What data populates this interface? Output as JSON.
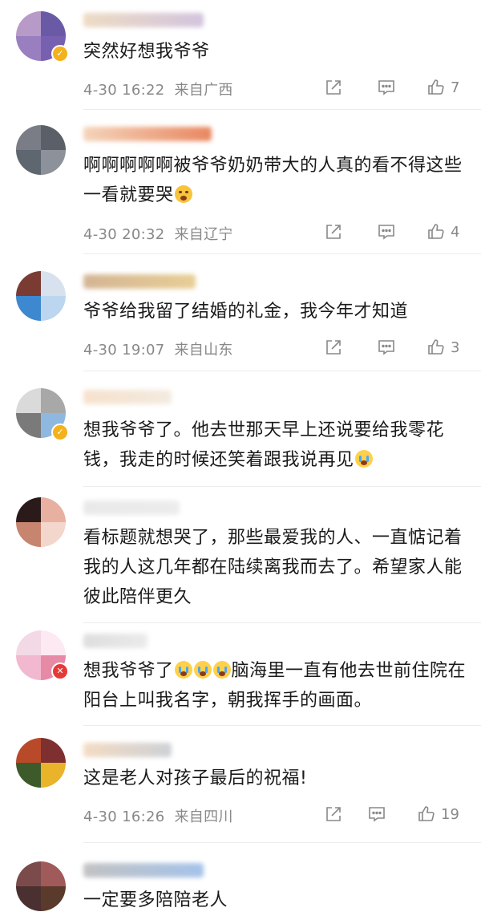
{
  "comments": [
    {
      "text": "突然好想我爷爷",
      "time": "4-30 16:22",
      "location": "来自广西",
      "likes": "7",
      "avatar_colors": [
        "#b89ac8",
        "#6a5aa6",
        "#9a7fc0",
        "#7860b0"
      ],
      "name_colors": [
        "#e9d3b5",
        "#c8b6d6"
      ],
      "badge": true
    },
    {
      "text": "啊啊啊啊啊被爷爷奶奶带大的人真的看不得这些 一看就要哭",
      "emoji": "tears",
      "time": "4-30 20:32",
      "location": "来自辽宁",
      "likes": "4",
      "avatar_colors": [
        "#7a7d86",
        "#5b6068",
        "#5e6670",
        "#8d9199"
      ],
      "name_colors": [
        "#f2c9a9",
        "#e36a3a"
      ],
      "badge": false
    },
    {
      "text": "爷爷给我留了结婚的礼金，我今年才知道",
      "time": "4-30 19:07",
      "location": "来自山东",
      "likes": "3",
      "avatar_colors": [
        "#7a3b33",
        "#d7e2ee",
        "#3e88cf",
        "#bcd6ef"
      ],
      "name_colors": [
        "#c9a37a",
        "#e3c27b"
      ],
      "badge": false
    },
    {
      "text": "想我爷爷了。他去世那天早上还说要给我零花钱，我走的时候还笑着跟我说再见",
      "emoji": "cry",
      "avatar_colors": [
        "#dadada",
        "#a8a8a8",
        "#7a7a7a",
        "#8fb8e0"
      ],
      "name_colors": [
        "#f4dac0",
        "#f0e6d8"
      ],
      "badge": true
    },
    {
      "text": "看标题就想哭了，那些最爱我的人、一直惦记着我的人这几年都在陆续离我而去了。希望家人能彼此陪伴更久",
      "avatar_colors": [
        "#2a1a1a",
        "#e8b0a0",
        "#c7846e",
        "#f3d6cc"
      ],
      "name_colors": [
        "#e4e4e4",
        "#e8e8e8"
      ],
      "badge": false
    },
    {
      "text": "想我爷爷了脑海里一直有他去世前住院在阳台上叫我名字，朝我挥手的画面。",
      "emoji_after_prefix": "想我爷爷了",
      "emoji_count": 3,
      "avatar_colors": [
        "#f3d9e6",
        "#fce9f2",
        "#f1b8cf",
        "#e68aa6"
      ],
      "name_colors": [
        "#d6d6d6",
        "#e6e6e6"
      ],
      "badge": true
    },
    {
      "text": "这是老人对孩子最后的祝福!",
      "time": "4-30 16:26",
      "location": "来自四川",
      "likes": "19",
      "avatar_colors": [
        "#b84a2a",
        "#7e2f2f",
        "#3d5a2a",
        "#e9b32a"
      ],
      "name_colors": [
        "#f1d3b5",
        "#c1c6cc"
      ],
      "badge": false
    },
    {
      "text": "一定要多陪陪老人",
      "avatar_colors": [
        "#7b4b4b",
        "#a05a5a",
        "#4a3030",
        "#5a3a2a"
      ],
      "name_colors": [
        "#b4b4b4",
        "#8fb4e6"
      ],
      "badge": false
    }
  ],
  "icons": {
    "share": "share-icon",
    "comment": "comment-icon",
    "like": "like-icon"
  }
}
